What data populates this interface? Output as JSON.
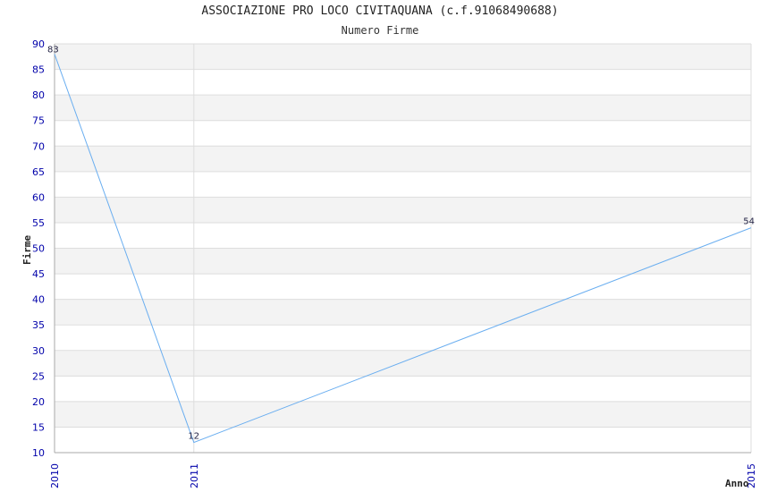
{
  "chart_data": {
    "type": "line",
    "title": "ASSOCIAZIONE PRO LOCO CIVITAQUANA (c.f.91068490688)",
    "subtitle": "Numero Firme",
    "xlabel": "Anno",
    "ylabel": "Firme",
    "x": [
      "2010",
      "2011",
      "2015"
    ],
    "series": [
      {
        "values": [
          88,
          12,
          54
        ],
        "data_labels": [
          "83",
          "12",
          "54"
        ]
      }
    ],
    "ylim": [
      10,
      90
    ],
    "yticks": [
      10,
      15,
      20,
      25,
      30,
      35,
      40,
      45,
      50,
      55,
      60,
      65,
      70,
      75,
      80,
      85,
      90
    ],
    "grid": true,
    "colors": {
      "line": "#6aaef0",
      "tick_label": "#0000aa",
      "band": "#f3f3f3",
      "gridline": "#dddddd"
    }
  }
}
